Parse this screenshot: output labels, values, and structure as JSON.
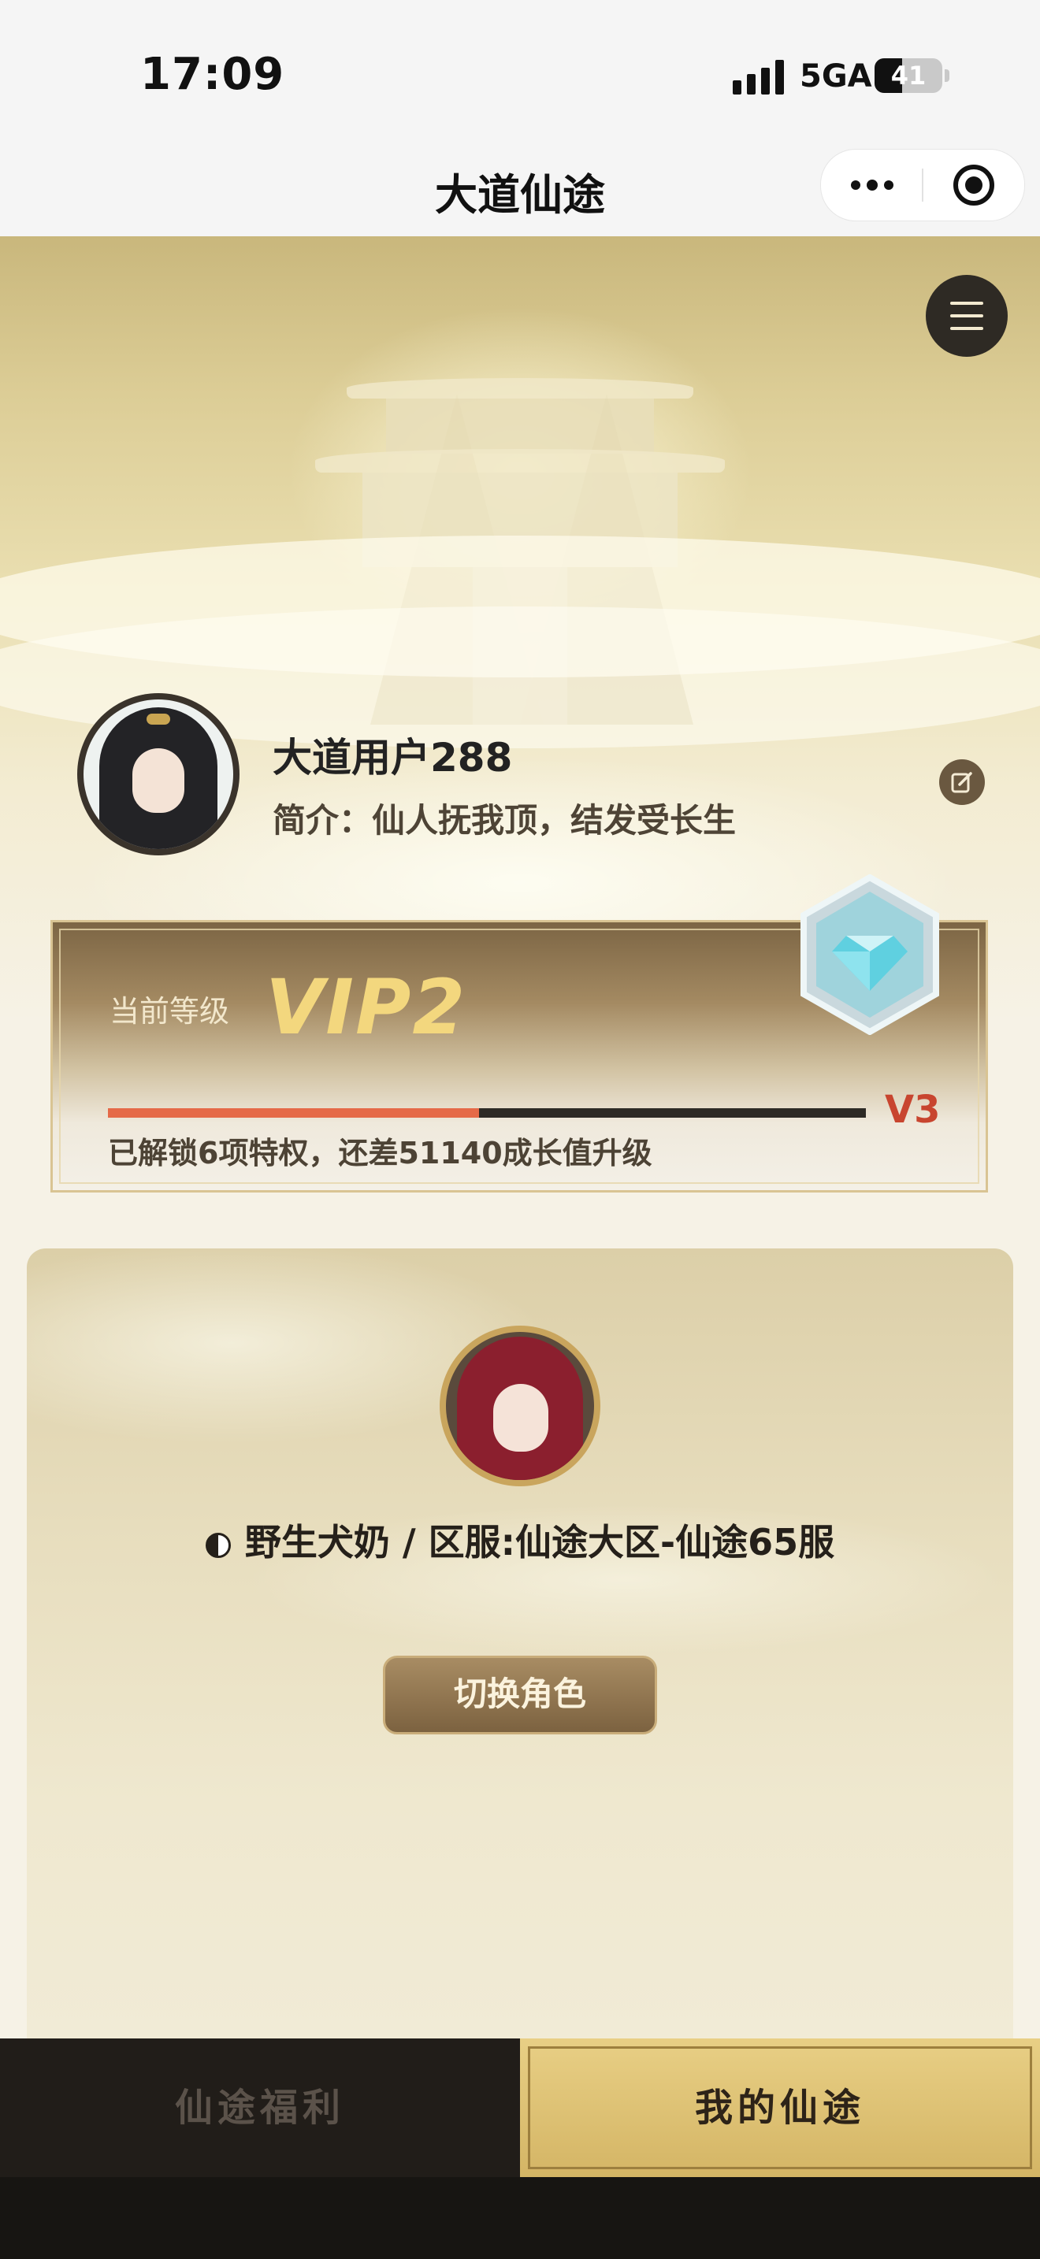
{
  "status_bar": {
    "time": "17:09",
    "network": "5GA",
    "battery": "41",
    "battery_percent": 41
  },
  "nav": {
    "title": "大道仙途",
    "more_icon": "more-dots-icon",
    "close_icon": "target-close-icon"
  },
  "profile": {
    "username": "大道用户288",
    "bio": "简介：仙人抚我顶，结发受长生",
    "edit_icon": "edit-icon"
  },
  "vip": {
    "current_label": "当前等级",
    "level": "VIP2",
    "next_level": "V3",
    "progress_fraction": 0.49,
    "description": "已解锁6项特权，还差51140成长值升级"
  },
  "role": {
    "name_server": "野生犬奶 / 区服:仙途大区-仙途65服",
    "switch_label": "切换角色"
  },
  "tabs": [
    {
      "label": "仙途福利",
      "active": false
    },
    {
      "label": "我的仙途",
      "active": true
    }
  ],
  "colors": {
    "accent_gold": "#f3d77e",
    "progress": "#e56a48",
    "next_level": "#c8452f"
  }
}
